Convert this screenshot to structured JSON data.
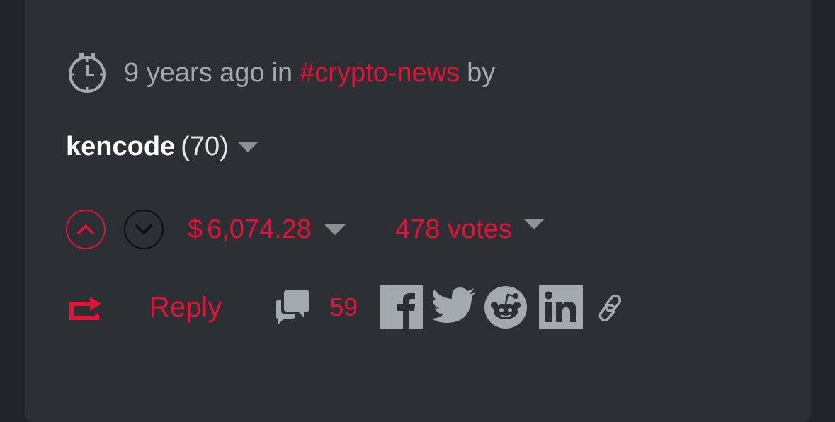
{
  "post_meta": {
    "time_ago": "9 years ago",
    "in_word": "in",
    "category": "#crypto-news",
    "by_word": "by"
  },
  "author": {
    "name": "kencode",
    "reputation": "(70)"
  },
  "voting": {
    "currency_symbol": "$",
    "payout": "6,074.28",
    "votes": "478 votes"
  },
  "actions": {
    "reply_label": "Reply",
    "comment_count": "59"
  },
  "icons": {
    "clock": "clock-icon",
    "upvote": "chevron-up-icon",
    "downvote": "chevron-down-icon",
    "reblog": "reblog-icon",
    "comments": "comments-icon",
    "share": [
      "facebook-icon",
      "twitter-icon",
      "reddit-icon",
      "linkedin-icon",
      "link-icon"
    ]
  },
  "colors": {
    "accent": "#e31337",
    "muted": "#a3a9ad",
    "card_bg": "#2c2f33",
    "page_bg": "#222429",
    "share_icon": "#a3a9ad"
  }
}
